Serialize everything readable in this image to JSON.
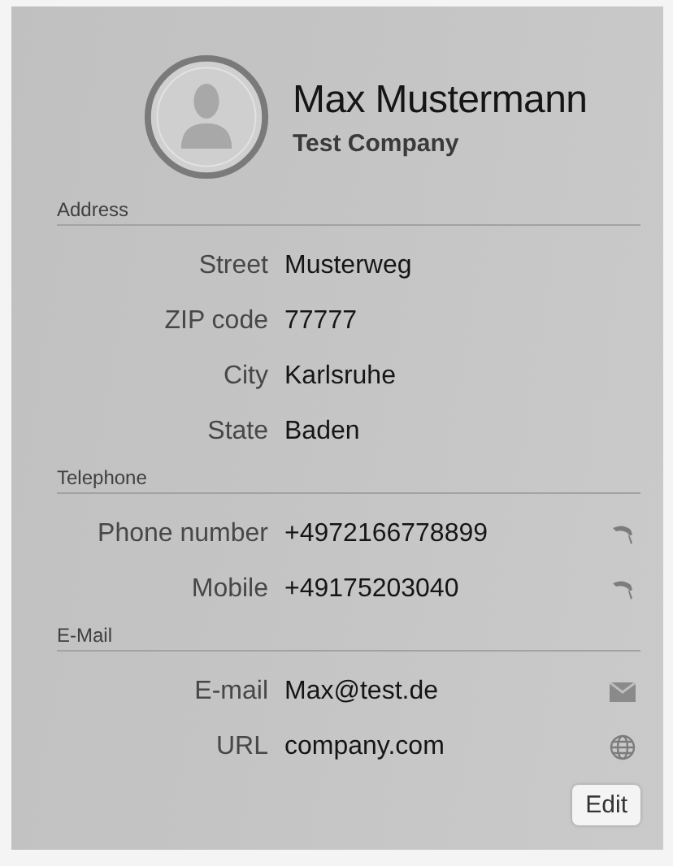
{
  "contact": {
    "name": "Max Mustermann",
    "company": "Test Company"
  },
  "sections": [
    {
      "title": "Address",
      "rows": [
        {
          "label": "Street",
          "value": "Musterweg",
          "kind": "plain"
        },
        {
          "label": "ZIP code",
          "value": "77777",
          "kind": "plain"
        },
        {
          "label": "City",
          "value": "Karlsruhe",
          "kind": "plain"
        },
        {
          "label": "State",
          "value": "Baden",
          "kind": "plain"
        }
      ]
    },
    {
      "title": "Telephone",
      "rows": [
        {
          "label": "Phone number",
          "value": "+4972166778899",
          "kind": "phone"
        },
        {
          "label": "Mobile",
          "value": "+49175203040",
          "kind": "phone"
        }
      ]
    },
    {
      "title": "E-Mail",
      "rows": [
        {
          "label": "E-mail",
          "value": "Max@test.de",
          "kind": "email"
        },
        {
          "label": "URL",
          "value": "company.com",
          "kind": "web"
        }
      ]
    }
  ],
  "buttons": [
    "Edit"
  ]
}
